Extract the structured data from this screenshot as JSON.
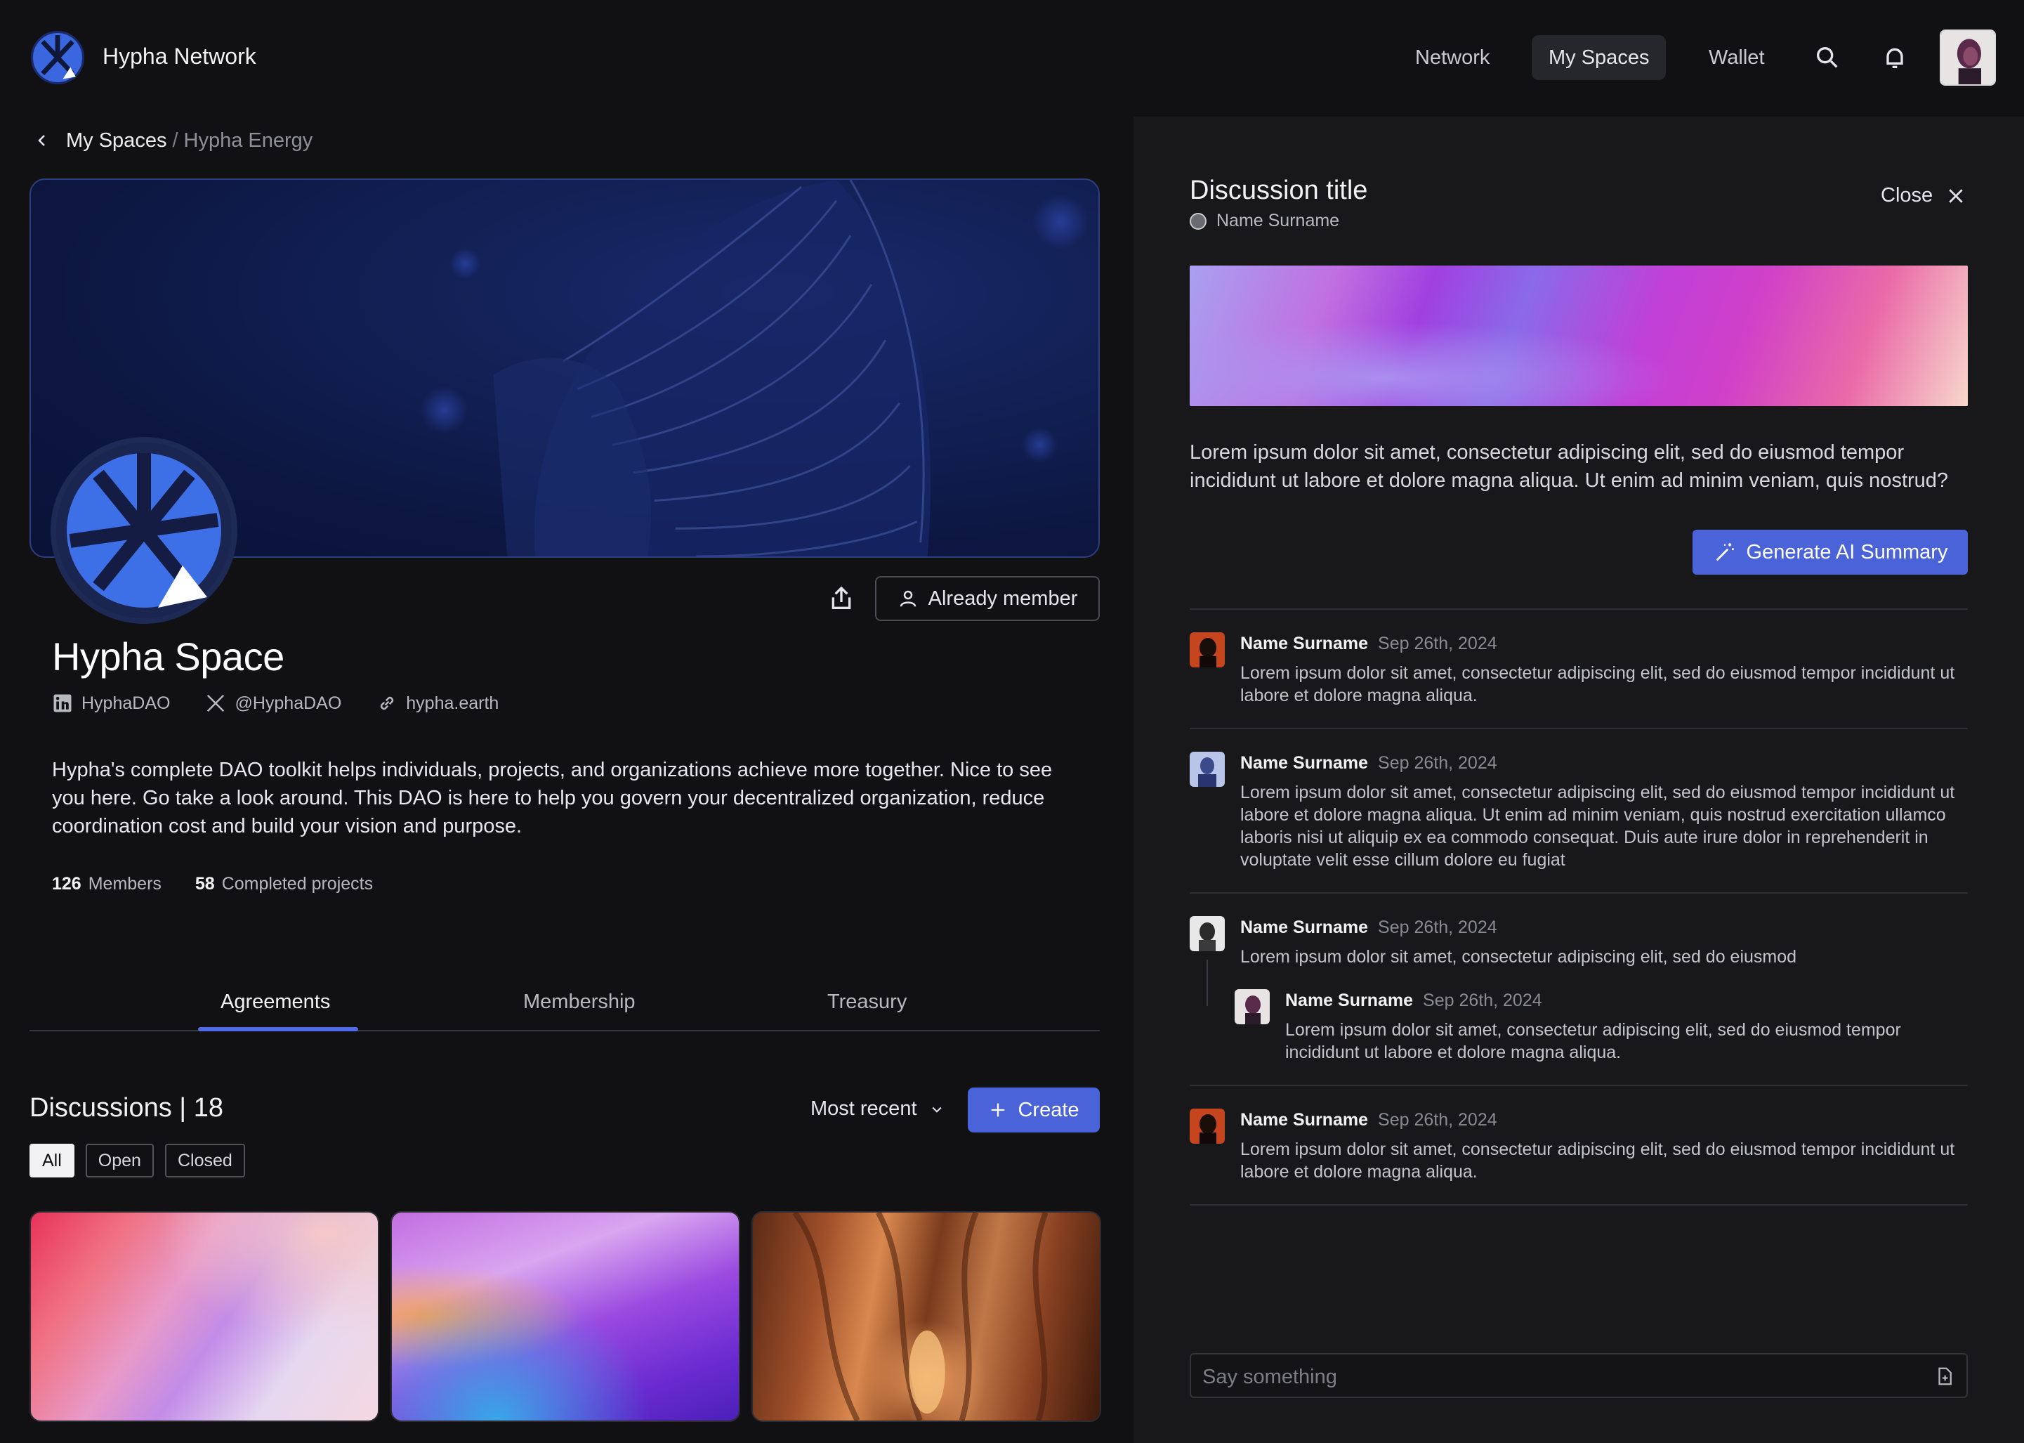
{
  "brand": {
    "name": "Hypha Network",
    "logo_icon": "hypha-logo-icon"
  },
  "nav": {
    "items": [
      "Network",
      "My Spaces",
      "Wallet"
    ],
    "active": "My Spaces",
    "icons": [
      "search-icon",
      "bell-icon",
      "avatar"
    ]
  },
  "breadcrumb": {
    "parent": "My Spaces",
    "separator": "/",
    "current": "Hypha Energy"
  },
  "space": {
    "title": "Hypha Space",
    "member_button": "Already member",
    "socials": [
      {
        "icon": "linkedin-icon",
        "label": "HyphaDAO"
      },
      {
        "icon": "x-icon",
        "label": "@HyphaDAO"
      },
      {
        "icon": "link-icon",
        "label": "hypha.earth"
      }
    ],
    "description": "Hypha's complete DAO toolkit helps individuals, projects, and organizations achieve more together. Nice to see you here. Go take a look around. This DAO is here to help you govern your decentralized organization, reduce coordination cost and build your vision and purpose.",
    "stats": {
      "members_count": "126",
      "members_label": "Members",
      "projects_count": "58",
      "projects_label": "Completed projects"
    }
  },
  "tabs": [
    "Agreements",
    "Membership",
    "Treasury"
  ],
  "active_tab": "Agreements",
  "discussions": {
    "title": "Discussions | 18",
    "sort": "Most recent",
    "create": "Create",
    "filters": [
      "All",
      "Open",
      "Closed"
    ],
    "active_filter": "All"
  },
  "panel": {
    "title": "Discussion title",
    "author": "Name Surname",
    "close": "Close",
    "body": "Lorem ipsum dolor sit amet, consectetur adipiscing elit, sed do eiusmod tempor incididunt ut labore et dolore magna aliqua. Ut enim ad minim veniam, quis nostrud?",
    "ai_button": "Generate AI Summary",
    "comments": [
      {
        "name": "Name Surname",
        "date": "Sep 26th, 2024",
        "text": "Lorem ipsum dolor sit amet, consectetur adipiscing elit, sed do eiusmod tempor incididunt ut labore et dolore magna aliqua."
      },
      {
        "name": "Name Surname",
        "date": "Sep 26th, 2024",
        "text": "Lorem ipsum dolor sit amet, consectetur adipiscing elit, sed do eiusmod tempor incididunt ut labore et dolore magna aliqua. Ut enim ad minim veniam, quis nostrud exercitation ullamco laboris nisi ut aliquip ex ea commodo consequat. Duis aute irure dolor in reprehenderit in voluptate velit esse cillum dolore eu fugiat"
      },
      {
        "name": "Name Surname",
        "date": "Sep 26th, 2024",
        "text": "Lorem ipsum dolor sit amet, consectetur adipiscing elit, sed do eiusmod",
        "reply": {
          "name": "Name Surname",
          "date": "Sep 26th, 2024",
          "text": "Lorem ipsum dolor sit amet, consectetur adipiscing elit, sed do eiusmod tempor incididunt ut labore et dolore magna aliqua."
        }
      },
      {
        "name": "Name Surname",
        "date": "Sep 26th, 2024",
        "text": "Lorem ipsum dolor sit amet, consectetur adipiscing elit, sed do eiusmod tempor incididunt ut labore et dolore magna aliqua."
      }
    ],
    "input_placeholder": "Say something"
  },
  "colors": {
    "accent": "#4b63d8",
    "background": "#111113",
    "panel": "#18181b"
  }
}
